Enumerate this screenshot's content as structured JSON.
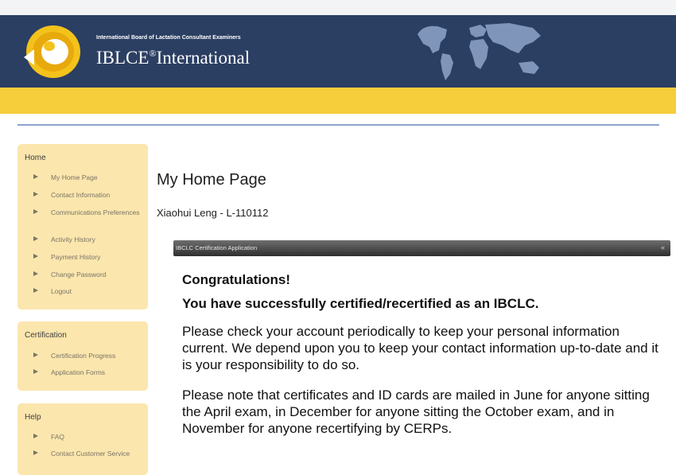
{
  "header": {
    "org_name": "International Board of Lactation Consultant Examiners",
    "brand_name": "IBLCE",
    "brand_mark": "®",
    "brand_suffix": "International",
    "colors": {
      "header_bg": "#2b3f63",
      "accent_band": "#f6cd3a",
      "sidebar_panel": "#fbe6ad"
    }
  },
  "sidebar": {
    "home": {
      "title": "Home",
      "items": [
        {
          "label": "My Home Page",
          "icon": "triangle-bullet-icon"
        },
        {
          "label": "Contact Information",
          "icon": "triangle-bullet-icon"
        },
        {
          "label": "Communications Preferences",
          "icon": "triangle-bullet-icon"
        },
        {
          "label": "Activity History",
          "icon": "triangle-bullet-icon"
        },
        {
          "label": "Payment History",
          "icon": "triangle-bullet-icon"
        },
        {
          "label": "Change Password",
          "icon": "triangle-bullet-icon"
        },
        {
          "label": "Logout",
          "icon": "triangle-bullet-icon"
        }
      ]
    },
    "certification": {
      "title": "Certification",
      "items": [
        {
          "label": "Certification Progress",
          "icon": "triangle-bullet-icon"
        },
        {
          "label": "Application Forms",
          "icon": "triangle-bullet-icon"
        }
      ]
    },
    "help": {
      "title": "Help",
      "items": [
        {
          "label": "FAQ",
          "icon": "triangle-bullet-icon"
        },
        {
          "label": "Contact Customer Service",
          "icon": "triangle-bullet-icon"
        }
      ]
    }
  },
  "main": {
    "page_title": "My Home Page",
    "user_line": "Xiaohui Leng - L-110112",
    "app_panel": {
      "title": "IBCLC Certification Application",
      "close_icon": "«",
      "heading": "Congratulations!",
      "subheading": "You have successfully certified/recertified as an IBCLC.",
      "paragraph1": "Please check your account periodically to keep your personal information current. We depend upon you to keep your contact information up-to-date and it is your responsibility to do so.",
      "paragraph2": "Please note that certificates and ID cards are mailed in June for anyone sitting the April exam, in December for anyone sitting the October exam, and in November for anyone recertifying by CERPs."
    }
  }
}
